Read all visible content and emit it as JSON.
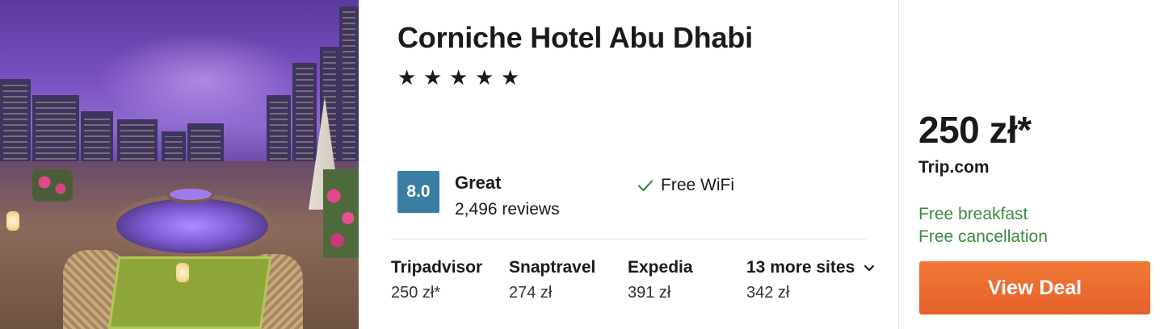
{
  "hotel": {
    "name": "Corniche Hotel Abu Dhabi",
    "stars": 5,
    "photo_icon": "hotel-terrace-photo"
  },
  "rating": {
    "score": "8.0",
    "word": "Great",
    "reviews": "2,496 reviews",
    "badge_color": "#3b7ea3"
  },
  "amenities": [
    {
      "label": "Free WiFi",
      "icon": "check-icon",
      "color": "#3a8a3f"
    }
  ],
  "sites": [
    {
      "name": "Tripadvisor",
      "price": "250 zł*"
    },
    {
      "name": "Snaptravel",
      "price": "274 zł"
    },
    {
      "name": "Expedia",
      "price": "391 zł"
    },
    {
      "name": "13 more sites",
      "price": "342 zł",
      "icon": "chevron-down-icon"
    }
  ],
  "deal": {
    "price": "250 zł*",
    "provider": "Trip.com",
    "perks": [
      "Free breakfast",
      "Free cancellation"
    ],
    "perk_color": "#3a8a3f",
    "button_label": "View Deal",
    "button_color": "#e5602b"
  }
}
